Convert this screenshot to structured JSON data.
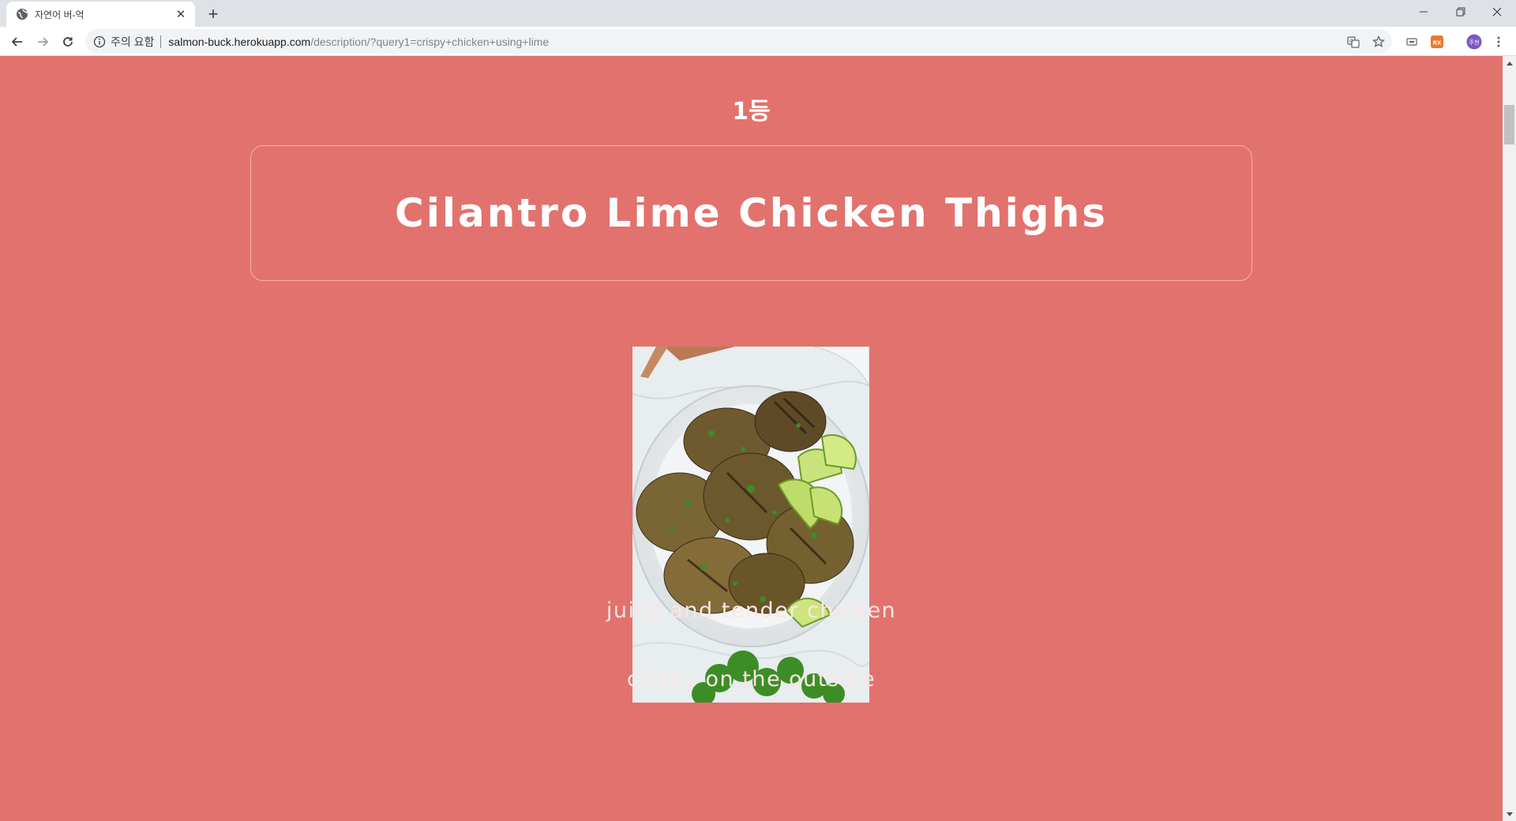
{
  "browser": {
    "tab": {
      "title": "자연어 버-억",
      "favicon": "globe-icon"
    },
    "address": {
      "security_label": "주의 요함",
      "url_host": "salmon-buck.herokuapp.com",
      "url_path": "/description/?query1=crispy+chicken+using+lime"
    },
    "profile_initials": "주현",
    "extension_badge": "RX"
  },
  "page": {
    "rank": "1등",
    "title": "Cilantro Lime Chicken Thighs",
    "image_alt": "grilled chicken thighs with lime wedges and cilantro",
    "descriptions": [
      "juicy and tender chicken",
      "crispy on the outside"
    ]
  },
  "colors": {
    "page_background": "#e2726d",
    "text_primary": "#ffffff",
    "text_secondary": "#fbe6e4"
  }
}
